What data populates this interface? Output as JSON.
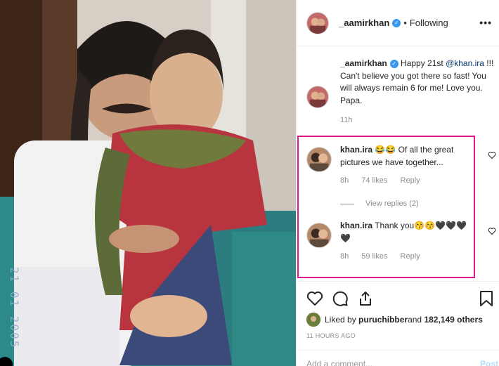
{
  "post": {
    "username": "_aamirkhan",
    "follow_status": "Following",
    "separator": "•",
    "more_label": "•••"
  },
  "caption": {
    "username": "_aamirkhan",
    "text_before_mention": " Happy 21st ",
    "mention": "@khan.ira",
    "text_after_mention": " !!! Can't believe you got there so fast! You will always remain 6 for me! Love you. Papa.",
    "time": "11h"
  },
  "photo": {
    "date_stamp": "21 01 2005"
  },
  "comments": [
    {
      "username": "khan.ira",
      "text": " 😂😂 Of all the great pictures we have together...",
      "time": "8h",
      "likes": "74 likes",
      "reply_label": "Reply"
    },
    {
      "username": "khan.ira",
      "text": " Thank you😚😚🖤🖤🖤🖤",
      "time": "8h",
      "likes": "59 likes",
      "reply_label": "Reply"
    }
  ],
  "view_replies": "View replies (2)",
  "liked_by": {
    "prefix": "Liked by ",
    "user": "puruchibber",
    "middle": " and ",
    "count": "182,149 others"
  },
  "posted_ago": "11 HOURS AGO",
  "add_comment": {
    "placeholder": "Add a comment...",
    "post_label": "Post"
  },
  "colors": {
    "highlight": "#e0198f",
    "verified": "#3897f0",
    "mention": "#003569",
    "post_disabled": "#b2dffc"
  }
}
